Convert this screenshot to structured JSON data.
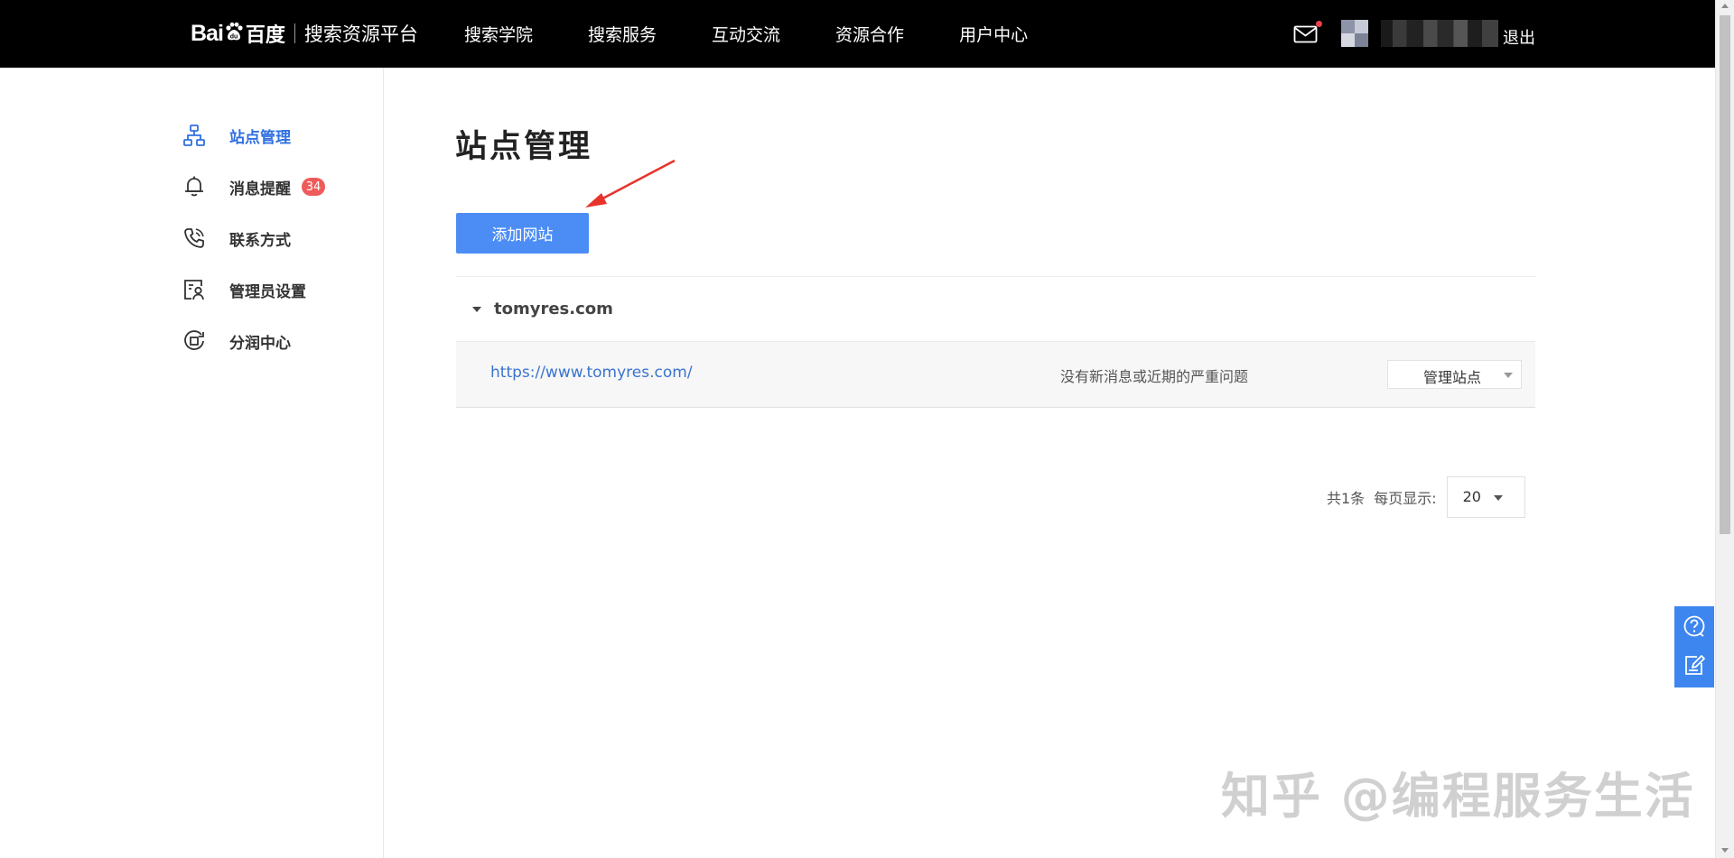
{
  "header": {
    "logo_text": "Bai",
    "logo_text_after": "百度",
    "logo_sub": "搜索资源平台",
    "nav": [
      {
        "label": "搜索学院"
      },
      {
        "label": "搜索服务"
      },
      {
        "label": "互动交流"
      },
      {
        "label": "资源合作"
      },
      {
        "label": "用户中心"
      }
    ],
    "logout_label": "退出",
    "mail_icon": "mail-icon",
    "notification_dot_color": "#f0424a"
  },
  "sidebar": {
    "items": [
      {
        "label": "站点管理",
        "icon": "sitemap-icon",
        "active": true
      },
      {
        "label": "消息提醒",
        "icon": "bell-icon",
        "badge": "34"
      },
      {
        "label": "联系方式",
        "icon": "phone-icon"
      },
      {
        "label": "管理员设置",
        "icon": "admin-card-icon"
      },
      {
        "label": "分润中心",
        "icon": "revenue-icon"
      }
    ],
    "active_color": "#3070e0",
    "badge_color": "#ef5a5a"
  },
  "main": {
    "title": "站点管理",
    "add_button_label": "添加网站",
    "button_color": "#4c8df5",
    "site": {
      "domain": "tomyres.com",
      "url": "https://www.tomyres.com/",
      "status": "没有新消息或近期的严重问题",
      "manage_label": "管理站点"
    },
    "pagination": {
      "total": "共1条",
      "per_page_label": "每页显示:",
      "per_page_value": "20"
    }
  },
  "float_tools": [
    {
      "icon": "help-icon"
    },
    {
      "icon": "feedback-edit-icon"
    }
  ],
  "watermark": "知乎 @编程服务生活"
}
